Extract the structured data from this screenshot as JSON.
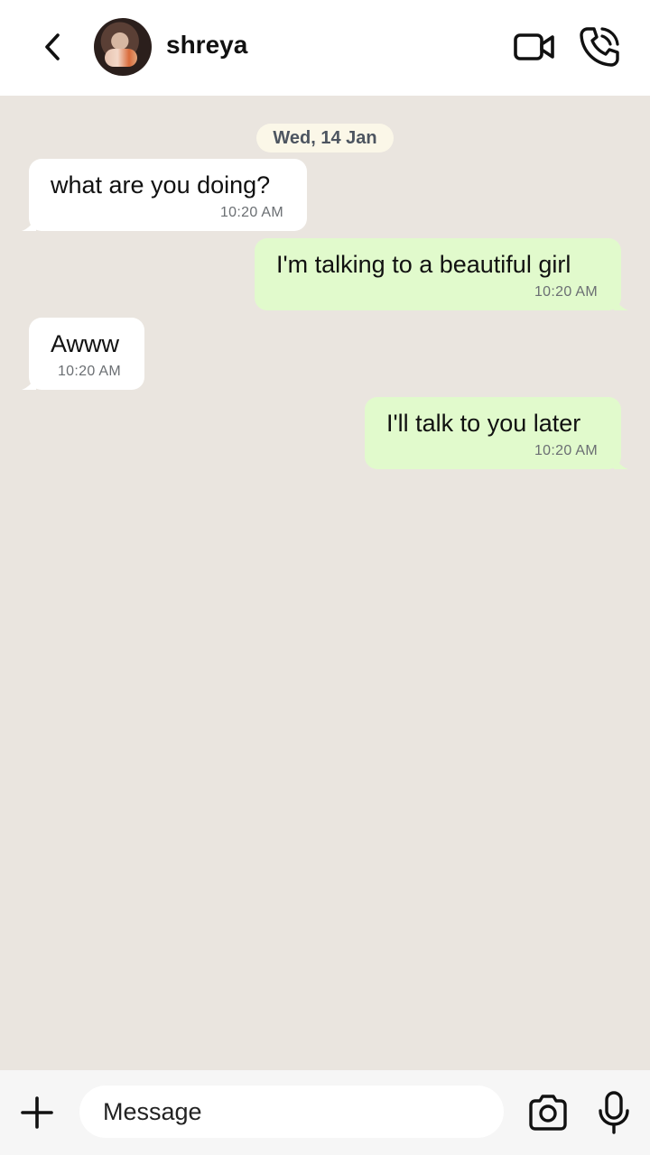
{
  "header": {
    "contact_name": "shreya",
    "back_icon": "chevron-left-icon",
    "video_icon": "video-camera-icon",
    "call_icon": "phone-icon"
  },
  "chat": {
    "date_label": "Wed, 14 Jan",
    "messages": [
      {
        "direction": "incoming",
        "text": "what are you doing?",
        "time": "10:20 AM"
      },
      {
        "direction": "outgoing",
        "text": "I'm talking to a beautiful girl",
        "time": "10:20 AM"
      },
      {
        "direction": "incoming",
        "text": "Awww",
        "time": "10:20 AM"
      },
      {
        "direction": "outgoing",
        "text": "I'll talk to you later",
        "time": "10:20 AM"
      }
    ]
  },
  "composer": {
    "placeholder": "Message",
    "plus_icon": "plus-icon",
    "camera_icon": "camera-icon",
    "mic_icon": "microphone-icon"
  },
  "colors": {
    "chat_background": "#EAE5DF",
    "incoming_bubble": "#FFFFFF",
    "outgoing_bubble": "#E1FACC",
    "date_chip": "#FBF7E8"
  }
}
